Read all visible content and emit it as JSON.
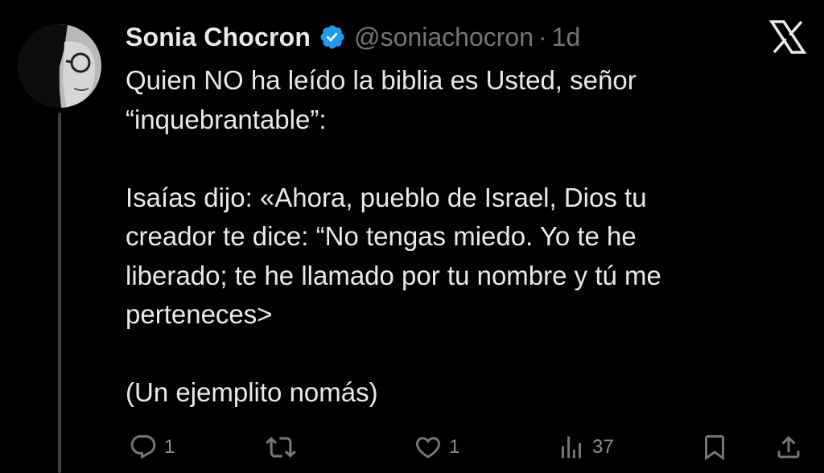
{
  "author": {
    "display_name": "Sonia Chocron",
    "handle": "@soniachocron",
    "separator": "·",
    "timestamp": "1d",
    "verified": true,
    "avatar_icon": "profile-photo"
  },
  "platform": {
    "logo_icon": "x-logo-icon"
  },
  "tweet": {
    "lines": [
      "Quien NO ha leído la biblia es Usted, señor",
      "“inquebrantable”:",
      "",
      "Isaías dijo: «Ahora, pueblo de Israel, Dios tu",
      "creador te dice: “No tengas miedo. Yo te he",
      "liberado; te he llamado por tu nombre y tú me",
      "perteneces>",
      "",
      "(Un ejemplito nomás)"
    ]
  },
  "actions": {
    "reply": {
      "icon": "reply-icon",
      "count": "1"
    },
    "retweet": {
      "icon": "retweet-icon",
      "count": ""
    },
    "like": {
      "icon": "heart-icon",
      "count": "1"
    },
    "views": {
      "icon": "views-icon",
      "count": "37"
    },
    "bookmark": {
      "icon": "bookmark-icon"
    },
    "share": {
      "icon": "share-icon"
    }
  },
  "colors": {
    "background": "#000000",
    "text_primary": "#e7e9ea",
    "text_secondary": "#71767b",
    "verified_blue": "#1d9bf0",
    "thread_line": "#3e4144"
  }
}
